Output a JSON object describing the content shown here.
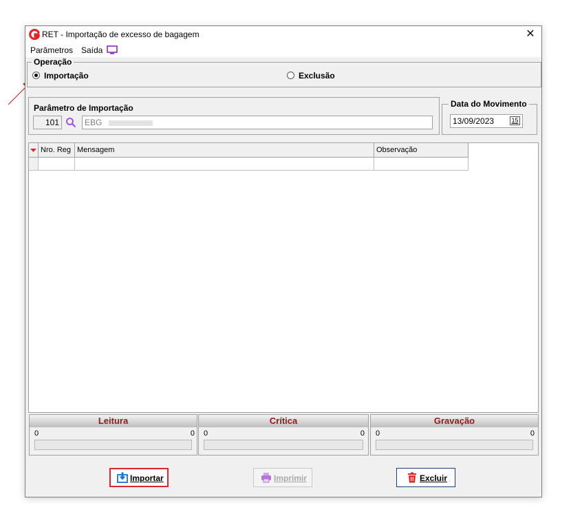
{
  "window": {
    "title": "RET - Importação de excesso de bagagem"
  },
  "menu": {
    "items": [
      "Parâmetros",
      "Saída"
    ]
  },
  "operation": {
    "legend": "Operação",
    "options": [
      {
        "label": "Importação",
        "selected": true
      },
      {
        "label": "Exclusão",
        "selected": false
      }
    ]
  },
  "import_param": {
    "legend": "Parâmetro de Importação",
    "code": "101",
    "description": "EBG"
  },
  "movement_date": {
    "legend": "Data do Movimento",
    "value": "13/09/2023",
    "calendar_label": "15"
  },
  "grid": {
    "columns": [
      "Nro. Reg",
      "Mensagem",
      "Observação"
    ],
    "rows": []
  },
  "panels": [
    {
      "title": "Leitura",
      "left_value": "0",
      "right_value": "0"
    },
    {
      "title": "Crítica",
      "left_value": "0",
      "right_value": "0"
    },
    {
      "title": "Gravação",
      "left_value": "0",
      "right_value": "0"
    }
  ],
  "buttons": {
    "import": "Importar",
    "print": "Imprimir",
    "delete": "Excluir"
  },
  "colors": {
    "accent_red": "#e0262a",
    "panel_title": "#8b1c1c",
    "highlight_border": "#d9272e",
    "purple_icon": "#8a2bb8"
  }
}
